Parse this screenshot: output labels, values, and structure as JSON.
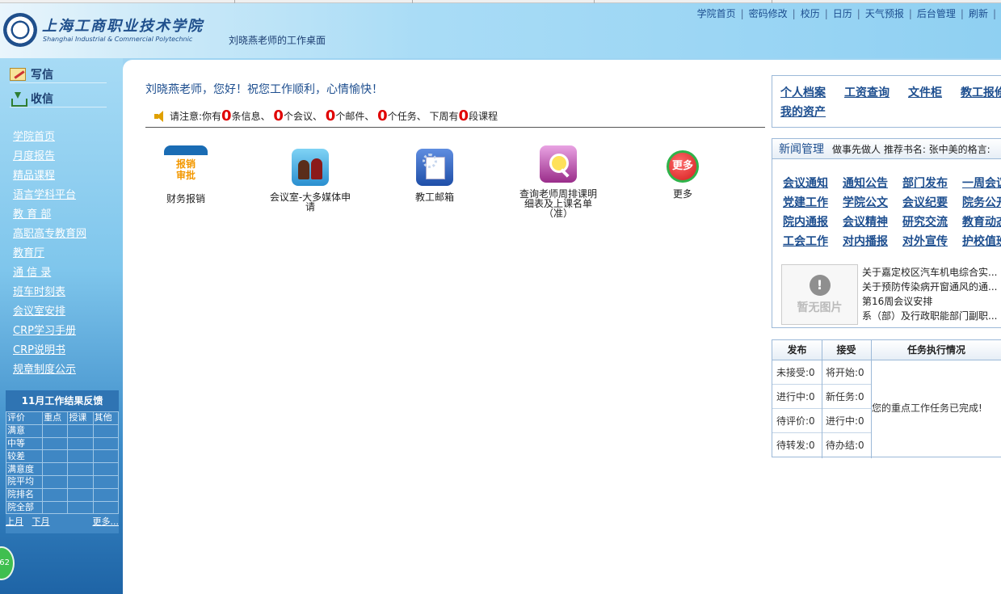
{
  "header": {
    "school_name_cn": "上海工商职业技术学院",
    "school_name_en": "Shanghai Industrial & Commercial Polytechnic",
    "desk_title": "刘晓燕老师的工作桌面",
    "nav": [
      "学院首页",
      "密码修改",
      "校历",
      "日历",
      "天气预报",
      "后台管理",
      "刷新"
    ]
  },
  "sidebar": {
    "write_label": "写信",
    "receive_label": "收信",
    "links": [
      "学院首页",
      "月度报告",
      "精品课程",
      "语言学科平台",
      "教 育 部",
      "高职高专教育网",
      "教育厅",
      "通 信 录",
      "班车时刻表",
      "会议室安排",
      "CRP学习手册",
      "CRP说明书",
      "规章制度公示"
    ],
    "feedback": {
      "title": "11月工作结果反馈",
      "headers": [
        "评价",
        "重点",
        "授课",
        "其他"
      ],
      "rows": [
        "满意",
        "中等",
        "较差",
        "满意度",
        "院平均",
        "院排名",
        "院全部"
      ],
      "prev": "上月",
      "next": "下月",
      "more": "更多..."
    },
    "counter": "62"
  },
  "main": {
    "greeting": "刘晓燕老师，您好！祝您工作顺利，心情愉快！",
    "notice": {
      "prefix": "请注意:你有",
      "info_count": "0",
      "info_label": "条信息、",
      "meeting_count": "0",
      "meeting_label": "个会议、",
      "mail_count": "0",
      "mail_label": "个邮件、",
      "task_count": "0",
      "task_label": "个任务、 下周有",
      "course_count": "0",
      "course_label": "段课程"
    },
    "apps": [
      {
        "label": "财务报销",
        "icon_text": "报销\n审批"
      },
      {
        "label": "会议室-大多媒体申请"
      },
      {
        "label": "教工邮箱"
      },
      {
        "label": "查询老师周排课明细表及上课名单（准）"
      },
      {
        "label": "更多",
        "icon_text": "更多"
      }
    ]
  },
  "right": {
    "quick_links_row1": [
      "个人档案",
      "工资查询",
      "文件柜",
      "教工报修"
    ],
    "quick_links_row2": [
      "我的资产"
    ],
    "news": {
      "title": "新闻管理",
      "motto": "做事先做人  推荐书名:  张中美的格言:",
      "categories": [
        [
          "会议通知",
          "通知公告",
          "部门发布",
          "一周会议"
        ],
        [
          "党建工作",
          "学院公文",
          "会议纪要",
          "院务公开"
        ],
        [
          "院内通报",
          "会议精神",
          "研究交流",
          "教育动态"
        ],
        [
          "工会工作",
          "对内播报",
          "对外宣传",
          "护校值班"
        ]
      ],
      "no_image": "暂无图片",
      "items": [
        "关于嘉定校区汽车机电综合实...",
        "关于预防传染病开窗通风的通...",
        "第16周会议安排",
        "系（部）及行政职能部门副职..."
      ]
    },
    "tasks": {
      "headers": [
        "发布",
        "接受",
        "任务执行情况"
      ],
      "publish": [
        "未接受:0",
        "进行中:0",
        "待评价:0",
        "待转发:0"
      ],
      "accept": [
        "将开始:0",
        "新任务:0",
        "进行中:0",
        "待办结:0"
      ],
      "status": "您的重点工作任务已完成!"
    }
  }
}
